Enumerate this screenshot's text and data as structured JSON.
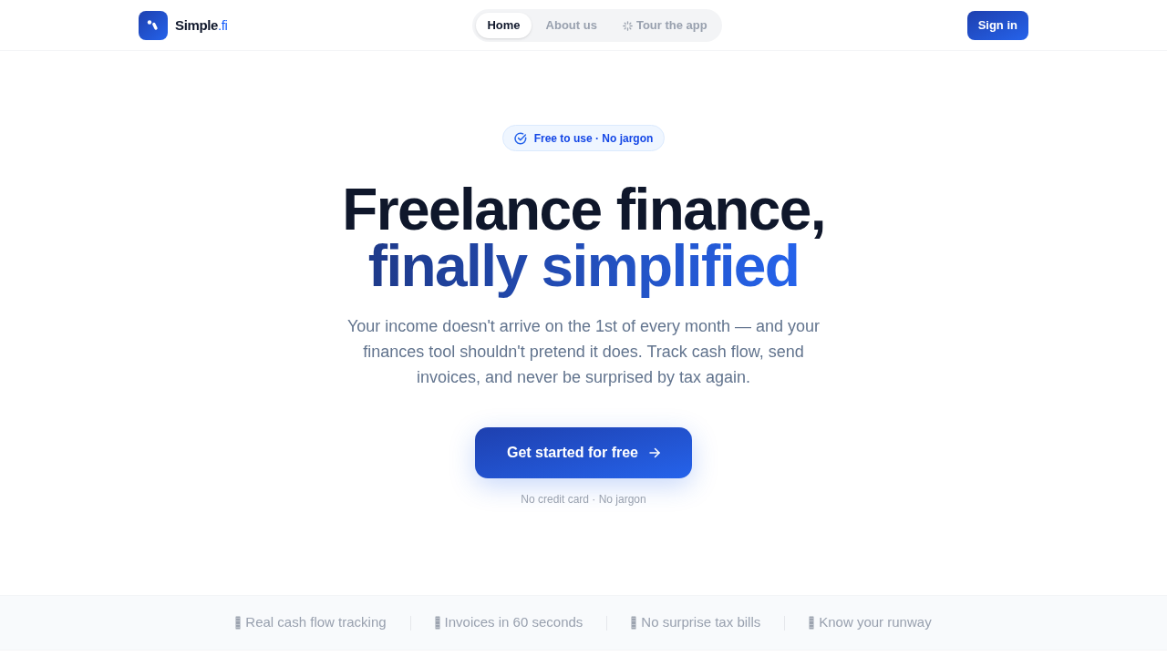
{
  "brand": {
    "name": "Simple",
    "suffix": ".fi"
  },
  "nav": {
    "tabs": [
      {
        "label": "Home",
        "selected": true,
        "kind": "plain"
      },
      {
        "label": "About us",
        "selected": false,
        "kind": "plain"
      },
      {
        "label": "Tour the app",
        "selected": false,
        "kind": "sparkle"
      }
    ]
  },
  "sign_in": {
    "label": "Sign in"
  },
  "hero": {
    "badge": "Free to use · No jargon",
    "headline": "Freelance finance,",
    "headline_accent": "finally simplified",
    "description": "Your income doesn't arrive on the 1st of every month — and your finances tool shouldn't pretend it does. Track cash flow, send invoices, and never be surprised by tax again.",
    "cta": "Get started for free",
    "note": "No credit card · No jargon"
  },
  "features": [
    {
      "label": "Real cash flow tracking"
    },
    {
      "label": "Invoices in 60 seconds"
    },
    {
      "label": "No surprise tax bills"
    },
    {
      "label": "Know your runway"
    }
  ]
}
